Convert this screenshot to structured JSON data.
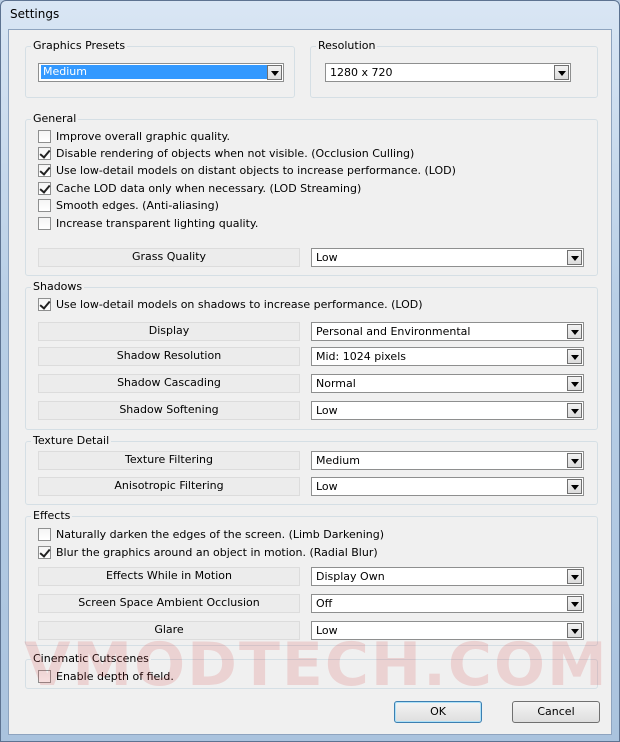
{
  "window": {
    "title": "Settings"
  },
  "presets": {
    "label": "Graphics Presets",
    "value": "Medium"
  },
  "resolution": {
    "label": "Resolution",
    "value": "1280 x 720"
  },
  "general": {
    "label": "General",
    "options": [
      {
        "label": "Improve overall graphic quality.",
        "checked": false
      },
      {
        "label": "Disable rendering of objects when not visible. (Occlusion Culling)",
        "checked": true
      },
      {
        "label": "Use low-detail models on distant objects to increase performance. (LOD)",
        "checked": true
      },
      {
        "label": "Cache LOD data only when necessary. (LOD Streaming)",
        "checked": true
      },
      {
        "label": "Smooth edges. (Anti-aliasing)",
        "checked": false
      },
      {
        "label": "Increase transparent lighting quality.",
        "checked": false
      }
    ],
    "grass_label": "Grass Quality",
    "grass_value": "Low"
  },
  "shadows": {
    "label": "Shadows",
    "lod_option": {
      "label": "Use low-detail models on shadows to increase performance. (LOD)",
      "checked": true
    },
    "settings": [
      {
        "label": "Display",
        "value": "Personal and Environmental"
      },
      {
        "label": "Shadow Resolution",
        "value": "Mid: 1024 pixels"
      },
      {
        "label": "Shadow Cascading",
        "value": "Normal"
      },
      {
        "label": "Shadow Softening",
        "value": "Low"
      }
    ]
  },
  "texture": {
    "label": "Texture Detail",
    "settings": [
      {
        "label": "Texture Filtering",
        "value": "Medium"
      },
      {
        "label": "Anisotropic Filtering",
        "value": "Low"
      }
    ]
  },
  "effects": {
    "label": "Effects",
    "options": [
      {
        "label": "Naturally darken the edges of the screen. (Limb Darkening)",
        "checked": false
      },
      {
        "label": "Blur the graphics around an object in motion. (Radial Blur)",
        "checked": true
      }
    ],
    "settings": [
      {
        "label": "Effects While in Motion",
        "value": "Display Own"
      },
      {
        "label": "Screen Space Ambient Occlusion",
        "value": "Off"
      },
      {
        "label": "Glare",
        "value": "Low"
      }
    ]
  },
  "cinematic": {
    "label": "Cinematic Cutscenes",
    "option": {
      "label": "Enable depth of field.",
      "checked": false
    }
  },
  "buttons": {
    "ok": "OK",
    "cancel": "Cancel"
  },
  "watermark": {
    "text": "VMODTECH.COM"
  }
}
